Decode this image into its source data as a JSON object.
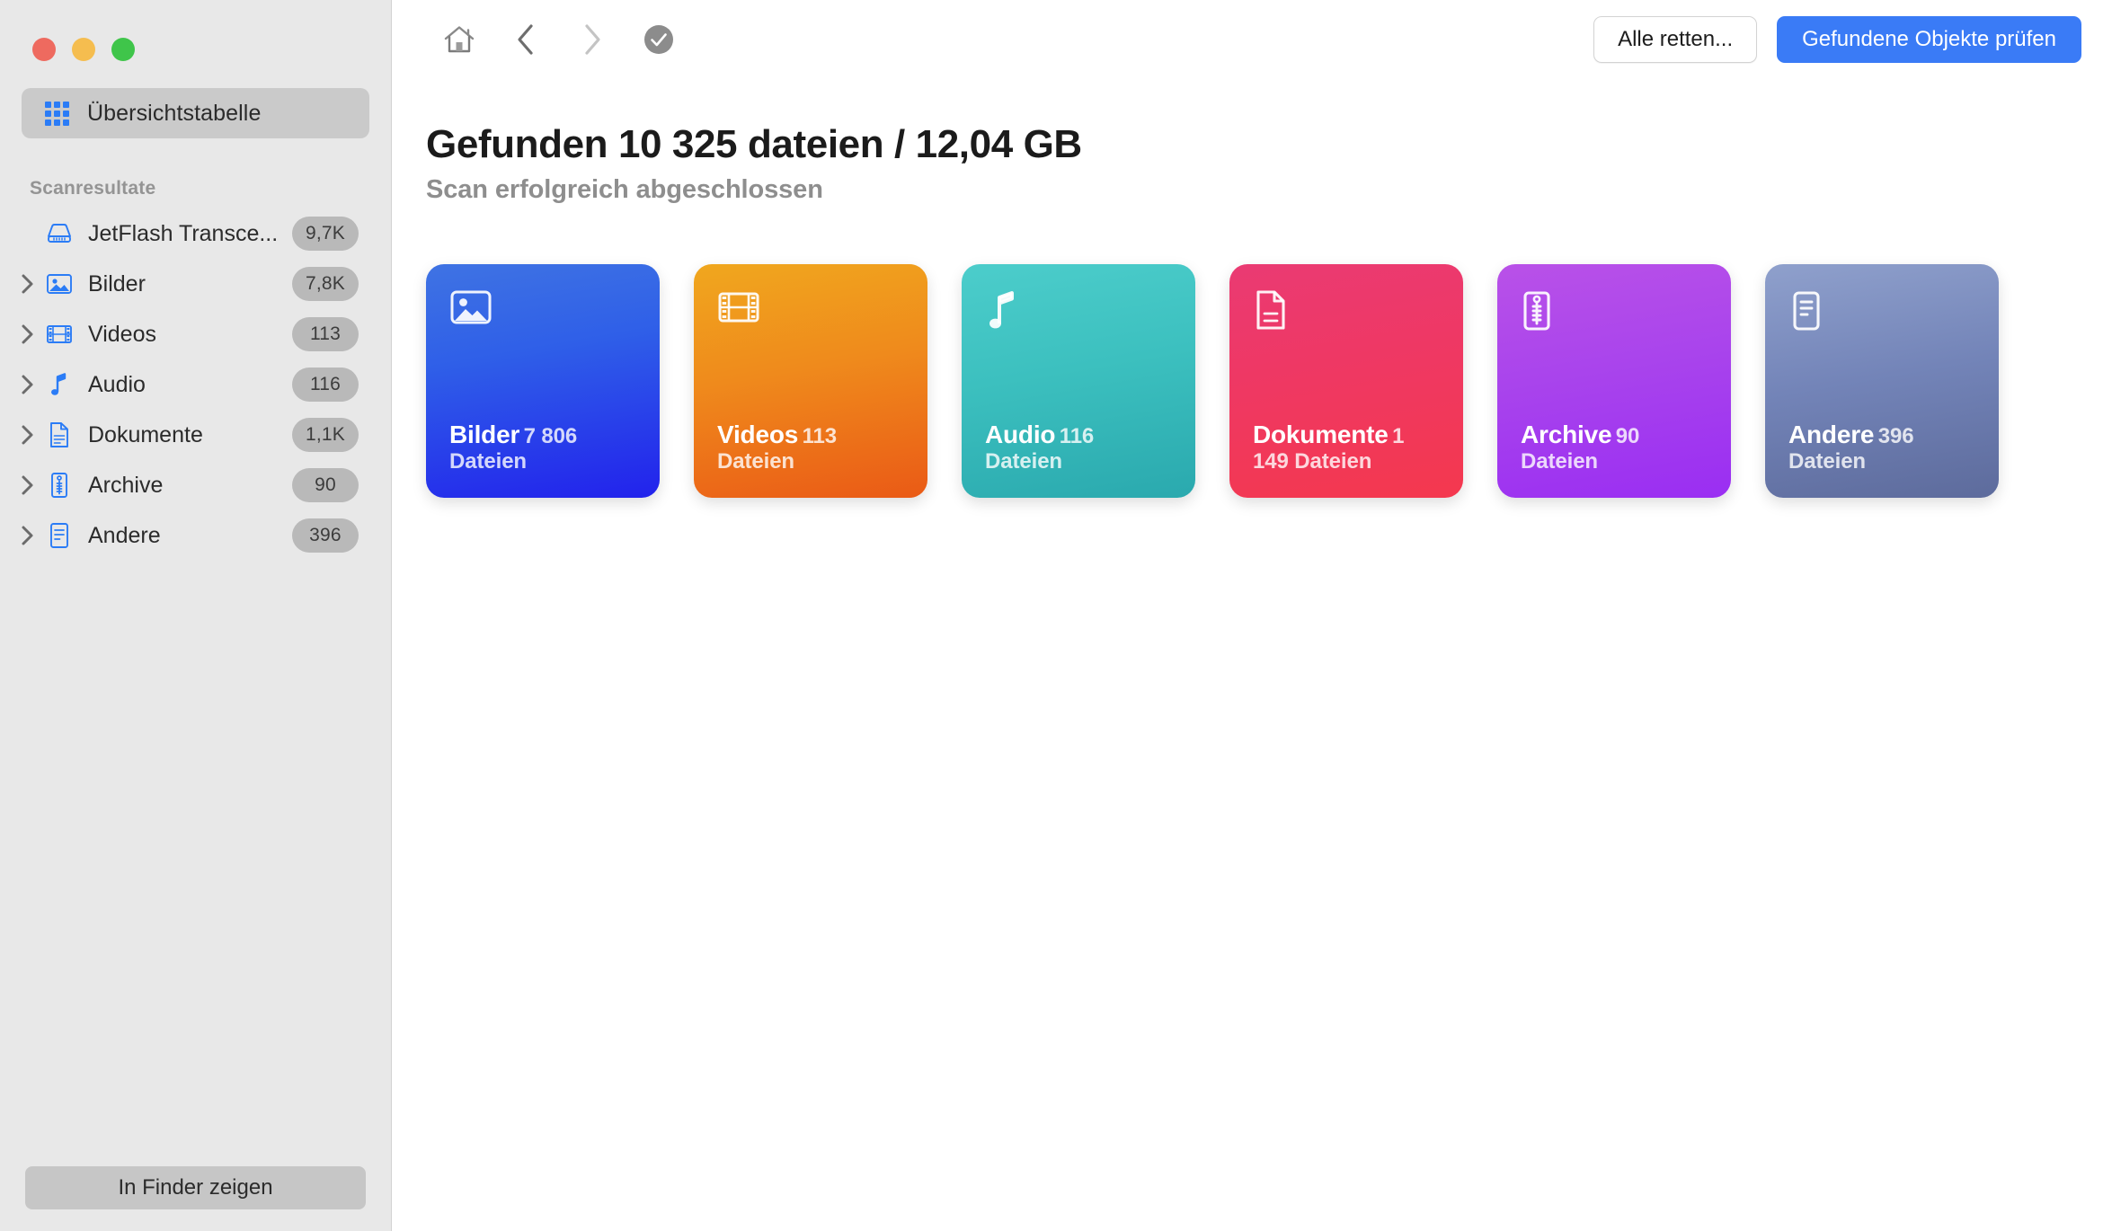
{
  "window": {
    "traffic_lights": [
      {
        "name": "close",
        "color": "#ee6a5f"
      },
      {
        "name": "minimize",
        "color": "#f5bd4f"
      },
      {
        "name": "zoom",
        "color": "#3fc54a"
      }
    ]
  },
  "sidebar": {
    "overview": {
      "label": "Übersichtstabelle",
      "icon": "grid-icon",
      "selected": true
    },
    "section_title": "Scanresultate",
    "items": [
      {
        "label": "JetFlash Transce...",
        "badge": "9,7K",
        "icon": "drive-icon",
        "expandable": false
      },
      {
        "label": "Bilder",
        "badge": "7,8K",
        "icon": "image-icon",
        "expandable": true
      },
      {
        "label": "Videos",
        "badge": "113",
        "icon": "film-icon",
        "expandable": true
      },
      {
        "label": "Audio",
        "badge": "116",
        "icon": "music-icon",
        "expandable": true
      },
      {
        "label": "Dokumente",
        "badge": "1,1K",
        "icon": "document-icon",
        "expandable": true
      },
      {
        "label": "Archive",
        "badge": "90",
        "icon": "archive-icon",
        "expandable": true
      },
      {
        "label": "Andere",
        "badge": "396",
        "icon": "other-icon",
        "expandable": true
      }
    ],
    "finder_button": "In Finder zeigen"
  },
  "toolbar": {
    "nav": [
      {
        "name": "home-icon",
        "enabled": true
      },
      {
        "name": "chevron-left-icon",
        "enabled": true
      },
      {
        "name": "chevron-right-icon",
        "enabled": false
      },
      {
        "name": "check-circle-icon",
        "enabled": true
      }
    ],
    "secondary_button": "Alle retten...",
    "primary_button": "Gefundene Objekte prüfen",
    "primary_color": "#3a7bf6"
  },
  "main": {
    "headline": "Gefunden 10 325 dateien / 12,04 GB",
    "subhead": "Scan erfolgreich abgeschlossen"
  },
  "tiles": [
    {
      "title": "Bilder",
      "count": "7 806 Dateien",
      "icon": "image-icon",
      "color": "#2f5fe8"
    },
    {
      "title": "Videos",
      "count": "113 Dateien",
      "icon": "film-icon",
      "color": "#ef8a1c"
    },
    {
      "title": "Audio",
      "count": "116 Dateien",
      "icon": "music-icon",
      "color": "#3cc0bf"
    },
    {
      "title": "Dokumente",
      "count": "1 149 Dateien",
      "icon": "document-icon",
      "color": "#ef3862"
    },
    {
      "title": "Archive",
      "count": "90 Dateien",
      "icon": "archive-icon",
      "color": "#a944ec"
    },
    {
      "title": "Andere",
      "count": "396 Dateien",
      "icon": "other-icon",
      "color": "#7384b8"
    }
  ]
}
